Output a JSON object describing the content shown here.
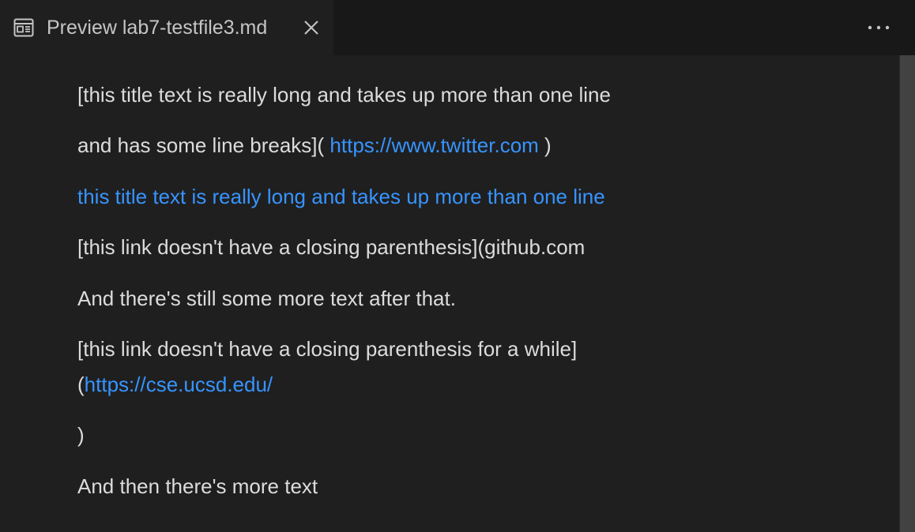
{
  "tab": {
    "icon": "preview-icon",
    "label": "Preview lab7-testfile3.md",
    "close_icon": "close-icon"
  },
  "toolbar": {
    "more_icon": "more-actions-icon"
  },
  "colors": {
    "background": "#1f1f1f",
    "tabbar": "#181818",
    "text": "#dcdcdc",
    "link": "#3794ff"
  },
  "document": {
    "line1": "[this title text is really long and takes up more than one line",
    "line2_prefix": "and has some line breaks](",
    "line2_link": "https://www.twitter.com",
    "line2_suffix": ")",
    "line3_link": "this title text is really long and takes up more than one line",
    "line4": "[this link doesn't have a closing parenthesis](github.com",
    "line5": "And there's still some more text after that.",
    "line6": "[this link doesn't have a closing parenthesis for a while]",
    "line7_prefix": "(",
    "line7_link": "https://cse.ucsd.edu/",
    "line8": ")",
    "line9": "And then there's more text"
  }
}
